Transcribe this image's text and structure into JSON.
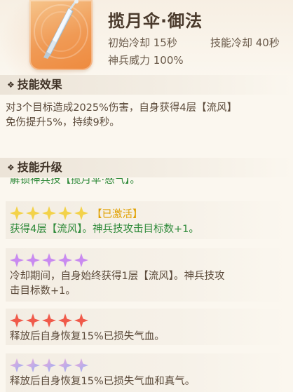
{
  "skill": {
    "name": "揽月伞·御法",
    "initial_cd": "初始冷却 15秒",
    "skill_cd": "技能冷却 40秒",
    "power": "神兵威力 100%"
  },
  "sections": {
    "effect_title": "技能效果",
    "upgrade_title": "技能升级"
  },
  "effect": {
    "line1": "对3个目标造成2025%伤害，自身获得4层【流风】",
    "line2": "免伤提升5%，持续9秒。"
  },
  "upgrades": {
    "cut_text": "解锁神兵技【揽月伞·惑气】。",
    "items": [
      {
        "stars_color": "gold",
        "badge": "【已激活】",
        "line1": "获得4层【流风】。神兵技攻击目标数+1。",
        "line2": ""
      },
      {
        "stars_color": "purple",
        "badge": "",
        "line1": "冷却期间，自身始终获得1层【流风】。神兵技攻",
        "line2": "击目标数+1。"
      },
      {
        "stars_color": "red",
        "badge": "",
        "line1": "释放后自身恢复15%已损失气血。",
        "line2": ""
      },
      {
        "stars_color": "rainbow",
        "badge": "",
        "line1": "释放后自身恢复15%已损失气血和真气。",
        "line2": ""
      }
    ]
  },
  "colors": {
    "gold": "#f3d24a",
    "purple": "#c98af0",
    "red": "#f05a4a",
    "rainbow": "#a7b8f5",
    "active_green": "#2f8a3a"
  },
  "icons": {
    "skill_icon": "umbrella-icon",
    "section_marker": "diamond-icon",
    "star": "star-icon"
  }
}
